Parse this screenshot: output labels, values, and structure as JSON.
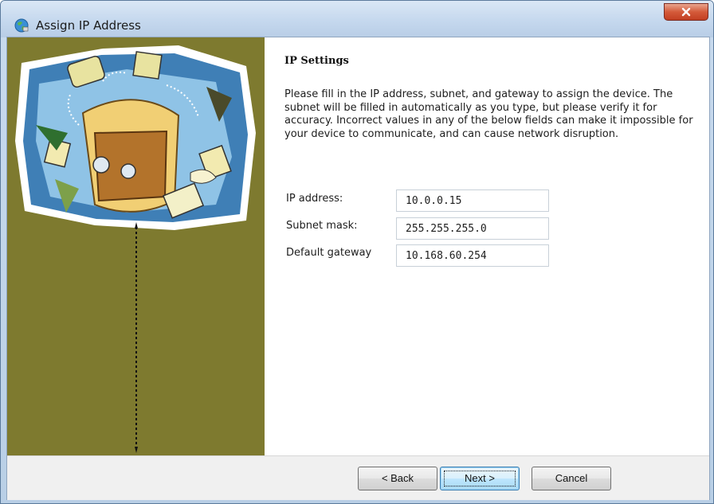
{
  "window": {
    "title": "Assign IP Address",
    "icon": "globe-network-icon",
    "close_icon": "close-icon"
  },
  "side_panel": {
    "background_color": "#7e7a2f",
    "illustration": "collage-illustration"
  },
  "content": {
    "heading": "IP Settings",
    "description": "Please fill in the IP address, subnet, and gateway to assign the device. The subnet will be filled in automatically as you type, but please verify it for accuracy.  Incorrect values in any of the below fields can make it impossible for your device to communicate, and can cause network disruption.",
    "fields": [
      {
        "label": "IP address:",
        "value": "10.0.0.15"
      },
      {
        "label": "Subnet mask:",
        "value": "255.255.255.0"
      },
      {
        "label": "Default gateway",
        "value": "10.168.60.254"
      }
    ]
  },
  "buttons": {
    "back": "< Back",
    "next": "Next >",
    "cancel": "Cancel"
  }
}
